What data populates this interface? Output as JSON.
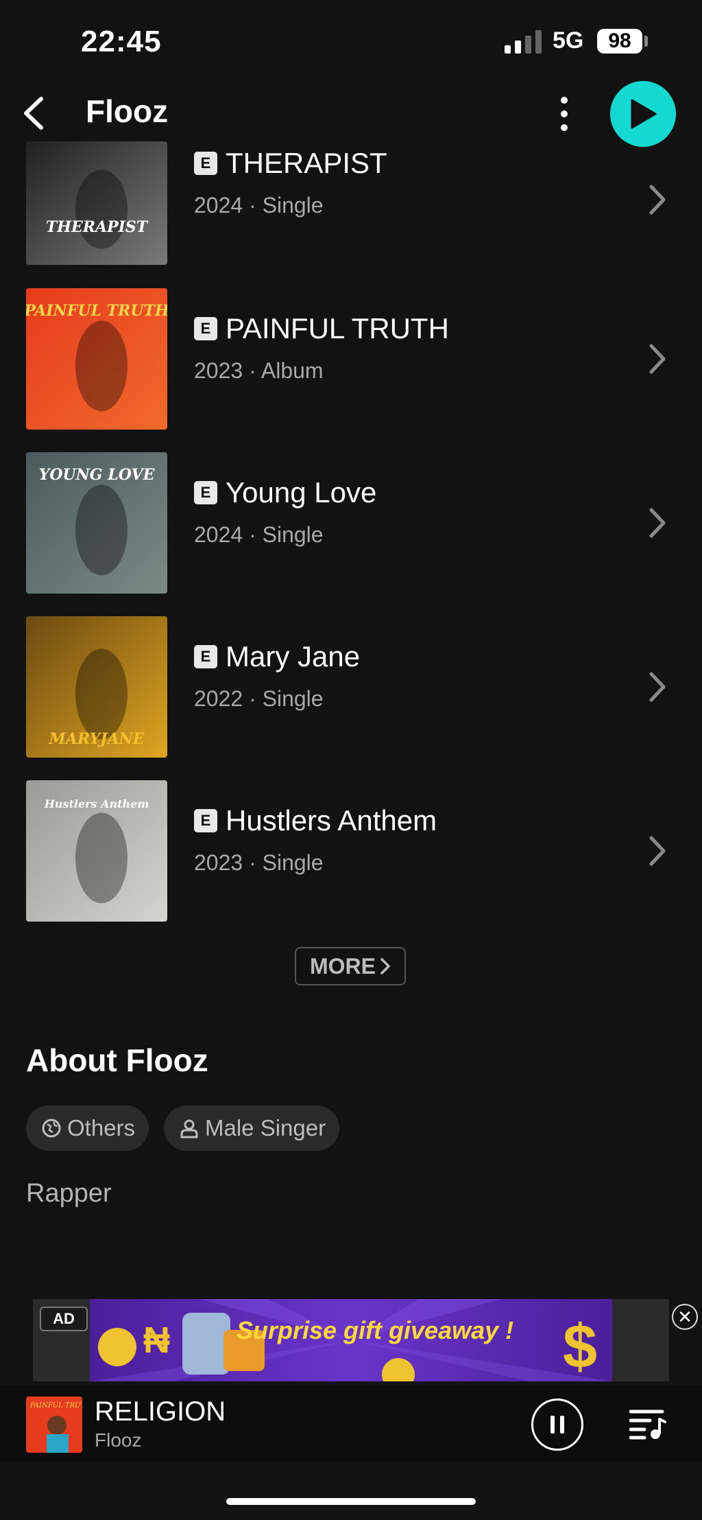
{
  "status": {
    "time": "22:45",
    "network": "5G",
    "battery": "98"
  },
  "header": {
    "title": "Flooz"
  },
  "releases": [
    {
      "title": "THERAPIST",
      "meta": "2024 · Single",
      "explicit": "E",
      "cover_text": "THERAPIST",
      "colors": [
        "#202020",
        "#7a7a7a"
      ]
    },
    {
      "title": "PAINFUL TRUTH",
      "meta": "2023 · Album",
      "explicit": "E",
      "cover_text": "PAINFUL TRUTH",
      "colors": [
        "#e63b1e",
        "#f06a2c"
      ]
    },
    {
      "title": "Young Love",
      "meta": "2024 · Single",
      "explicit": "E",
      "cover_text": "YOUNG LOVE",
      "colors": [
        "#4b5a5e",
        "#7d8a85"
      ]
    },
    {
      "title": "Mary Jane",
      "meta": "2022 · Single",
      "explicit": "E",
      "cover_text": "MARYJANE",
      "colors": [
        "#6b4a12",
        "#e0a521"
      ]
    },
    {
      "title": "Hustlers Anthem",
      "meta": "2023 · Single",
      "explicit": "E",
      "cover_text": "Hustlers Anthem",
      "colors": [
        "#9a9a98",
        "#d4d4d0"
      ]
    }
  ],
  "more_label": "MORE",
  "about": {
    "title": "About Flooz",
    "chips": [
      "Others",
      "Male Singer"
    ],
    "description": "Rapper"
  },
  "ad": {
    "label": "AD",
    "headline": "Surprise gift giveaway !"
  },
  "now_playing": {
    "title": "RELIGION",
    "artist": "Flooz",
    "cover_text": "PAINFUL TRUTH"
  }
}
